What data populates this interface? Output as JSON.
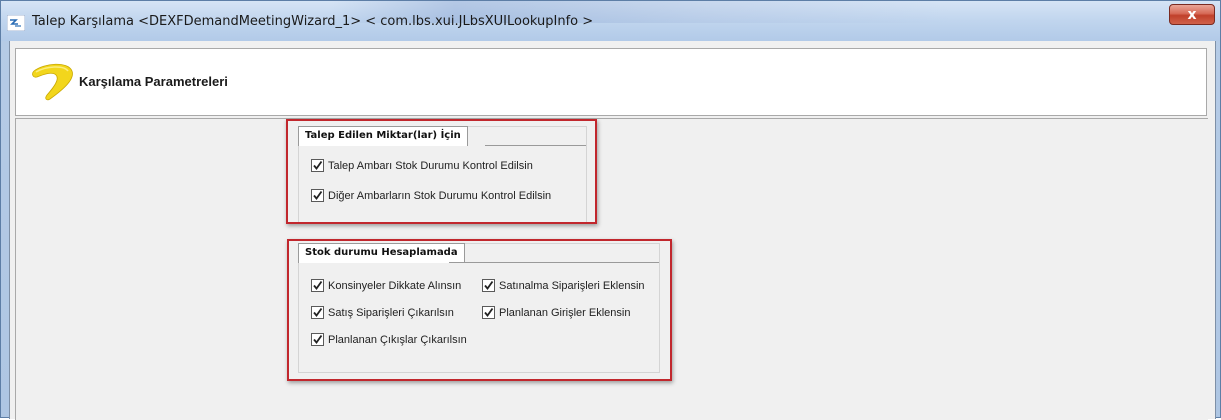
{
  "window": {
    "title": "Talep Karşılama <DEXFDemandMeetingWizard_1> < com.lbs.xui.JLbsXUILookupInfo >",
    "close_label": "x"
  },
  "header": {
    "title": "Karşılama Parametreleri"
  },
  "groups": [
    {
      "title": "Talep Edilen Miktar(lar) İçin",
      "items": [
        {
          "label": "Talep Ambarı Stok Durumu Kontrol Edilsin",
          "checked": true
        },
        {
          "label": "Diğer Ambarların Stok Durumu Kontrol Edilsin",
          "checked": true
        }
      ]
    },
    {
      "title": "Stok durumu Hesaplamada",
      "items": [
        {
          "label": "Konsinyeler Dikkate Alınsın",
          "checked": true
        },
        {
          "label": "Satınalma Siparişleri Eklensin",
          "checked": true
        },
        {
          "label": "Satış Siparişleri Çıkarılsın",
          "checked": true
        },
        {
          "label": "Planlanan Girişler Eklensin",
          "checked": true
        },
        {
          "label": "Planlanan Çıkışlar Çıkarılsın",
          "checked": true
        }
      ]
    }
  ],
  "colors": {
    "highlight": "#c1272d",
    "logo": "#f2d61c"
  }
}
